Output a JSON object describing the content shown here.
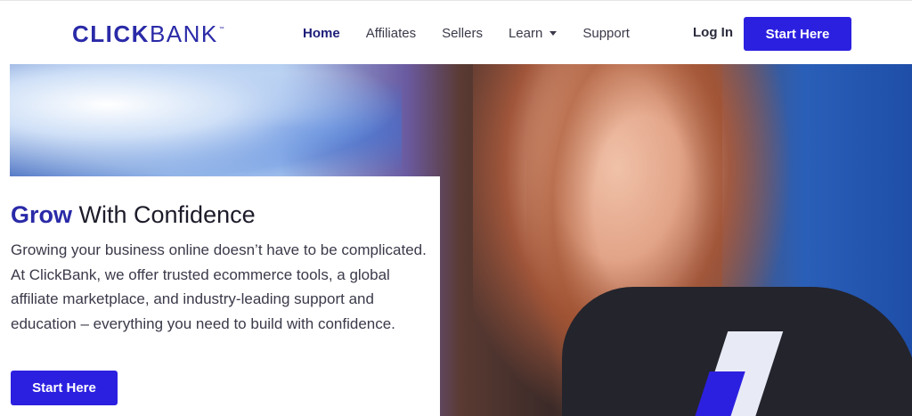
{
  "brand": {
    "logo_part1": "CLICK",
    "logo_part2": "BANK",
    "logo_tm": "™",
    "accent_color": "#2c20e0",
    "logo_color": "#2a2aa8"
  },
  "nav": {
    "items": [
      {
        "label": "Home",
        "active": true
      },
      {
        "label": "Affiliates",
        "active": false
      },
      {
        "label": "Sellers",
        "active": false
      },
      {
        "label": "Learn",
        "active": false,
        "has_dropdown": true
      },
      {
        "label": "Support",
        "active": false
      }
    ],
    "login_label": "Log In",
    "cta_label": "Start Here"
  },
  "hero": {
    "headline_strong": "Grow",
    "headline_rest": " With Confidence",
    "body": "Growing your business online doesn’t have to be complicated. At ClickBank, we offer trusted ecommerce tools, a global affiliate marketplace, and industry-leading support and education – everything you need to build with confidence.",
    "cta_label": "Start Here",
    "image_subject": "smiling-woman-photo"
  }
}
